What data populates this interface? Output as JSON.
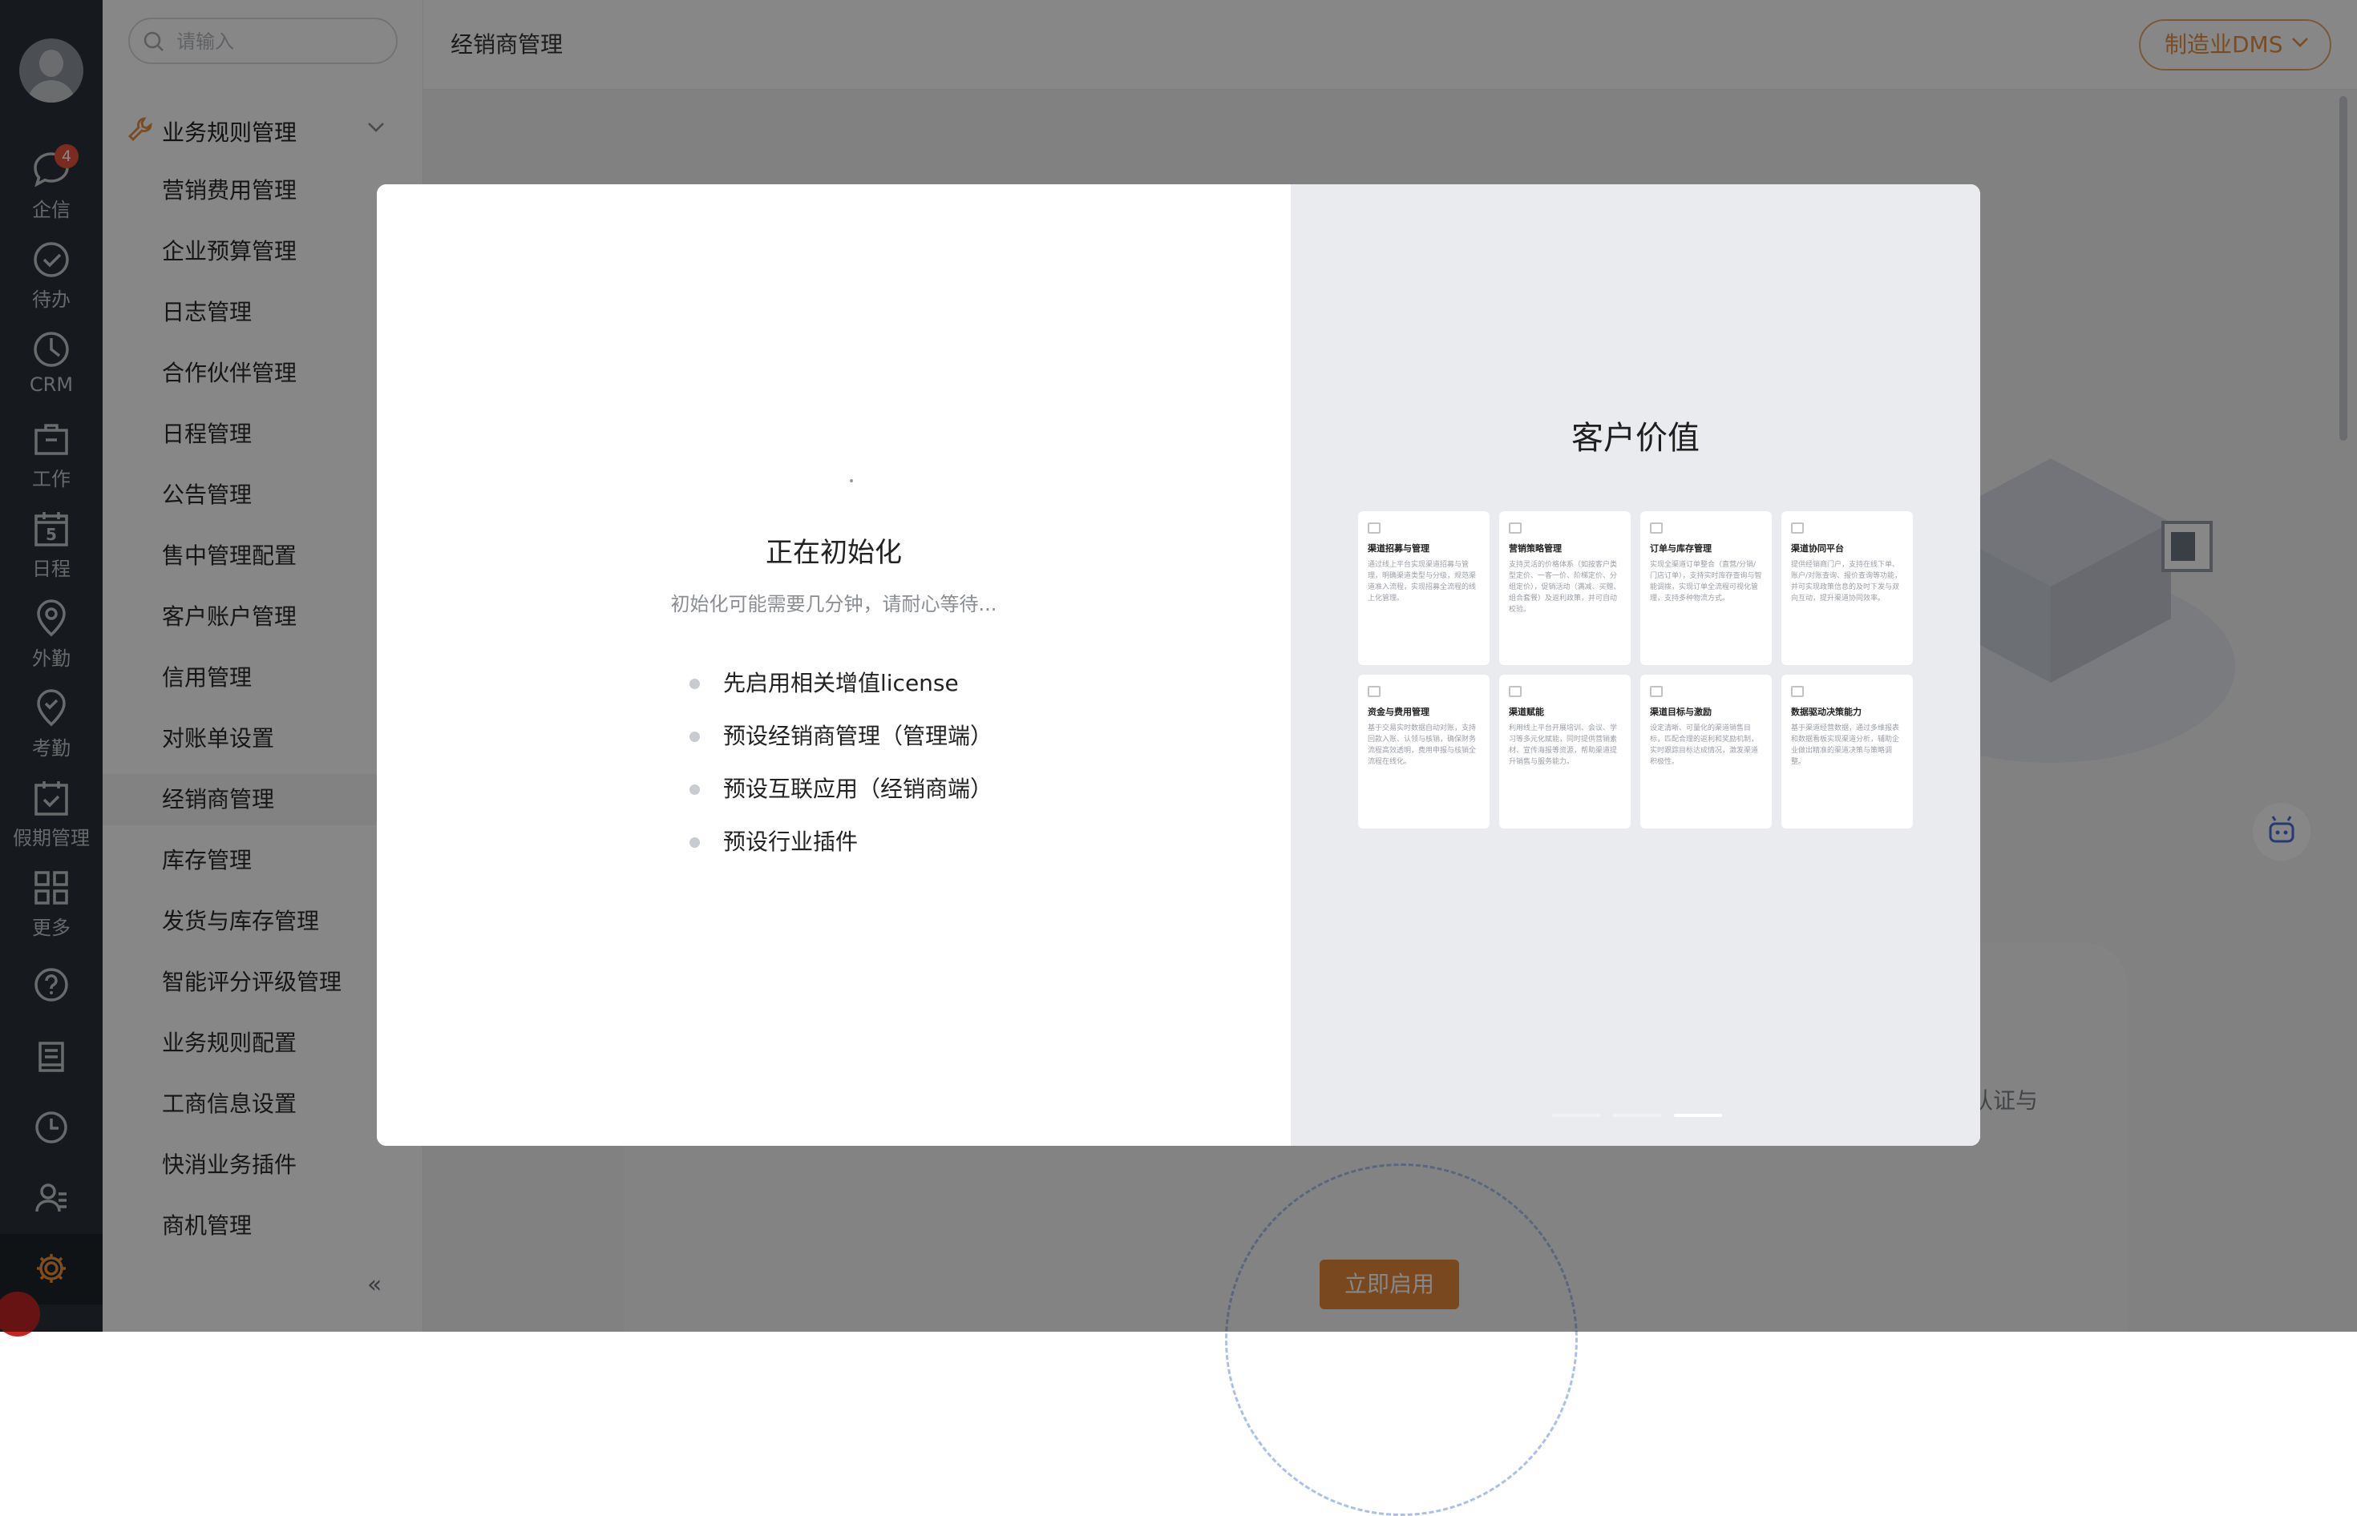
{
  "rail": {
    "items": [
      {
        "label": "企信",
        "icon": "chat-bubble-icon",
        "badge": "4"
      },
      {
        "label": "待办",
        "icon": "check-circle-icon"
      },
      {
        "label": "CRM",
        "icon": "clock-pie-icon"
      },
      {
        "label": "工作",
        "icon": "briefcase-icon"
      },
      {
        "label": "日程",
        "icon": "calendar-icon",
        "date": "5"
      },
      {
        "label": "外勤",
        "icon": "location-pin-icon"
      },
      {
        "label": "考勤",
        "icon": "check-pin-icon"
      },
      {
        "label": "假期管理",
        "icon": "calendar-check-icon"
      },
      {
        "label": "更多",
        "icon": "grid-icon"
      }
    ],
    "tools": [
      "help-icon",
      "notebook-icon",
      "history-clock-icon",
      "contacts-icon",
      "settings-gear-icon"
    ],
    "active_color": "#e8913f"
  },
  "sidebar": {
    "search_placeholder": "请输入",
    "group_label": "业务规则管理",
    "items": [
      {
        "label": "营销费用管理"
      },
      {
        "label": "企业预算管理"
      },
      {
        "label": "日志管理"
      },
      {
        "label": "合作伙伴管理"
      },
      {
        "label": "日程管理"
      },
      {
        "label": "公告管理"
      },
      {
        "label": "售中管理配置"
      },
      {
        "label": "客户账户管理"
      },
      {
        "label": "信用管理"
      },
      {
        "label": "对账单设置"
      },
      {
        "label": "经销商管理"
      },
      {
        "label": "库存管理"
      },
      {
        "label": "发货与库存管理"
      },
      {
        "label": "智能评分评级管理"
      },
      {
        "label": "业务规则配置"
      },
      {
        "label": "工商信息设置"
      },
      {
        "label": "快消业务插件"
      },
      {
        "label": "商机管理"
      }
    ],
    "active_item": "经销商管理",
    "collapse_label": "«"
  },
  "header": {
    "title": "经销商管理",
    "scenario_button": "制造业DMS"
  },
  "background_page": {
    "partial_text": "认证与",
    "enable_button": "立即启用"
  },
  "modal": {
    "left": {
      "title": "正在初始化",
      "subtitle": "初始化可能需要几分钟，请耐心等待...",
      "steps": [
        "先启用相关增值license",
        "预设经销商管理（管理端）",
        "预设互联应用（经销商端）",
        "预设行业插件"
      ]
    },
    "right": {
      "title": "客户价值",
      "cards": [
        {
          "title": "渠道招募与管理",
          "desc": "通过线上平台实现渠道招募与管理，明确渠道类型与分级，规范渠道准入流程，实现招募全流程的线上化管理。"
        },
        {
          "title": "营销策略管理",
          "desc": "支持灵活的价格体系（如按客户类型定价、一客一价、阶梯定价、分组定价），促销活动（满减、买赠、组合套餐）及返利政策，并可自动校验。"
        },
        {
          "title": "订单与库存管理",
          "desc": "实现全渠道订单整合（直营/分销/门店订单），支持实时库存查询与智能调拨，实现订单全流程可视化管理，支持多种物流方式。"
        },
        {
          "title": "渠道协同平台",
          "desc": "提供经销商门户，支持在线下单、账户/对账查询、报价查询等功能，并可实现政策信息的及时下发与双向互动，提升渠道协同效率。"
        },
        {
          "title": "资金与费用管理",
          "desc": "基于交易实时数据自动对账，支持回款入账、认领与核销，确保财务流程高效透明，费用申报与核销全流程在线化。"
        },
        {
          "title": "渠道赋能",
          "desc": "利用线上平台开展培训、会议、学习等多元化赋能，同时提供营销素材、宣传海报等资源，帮助渠道提升销售与服务能力。"
        },
        {
          "title": "渠道目标与激励",
          "desc": "设定清晰、可量化的渠道销售目标，匹配合理的返利和奖励机制，实时跟踪目标达成情况，激发渠道积极性。"
        },
        {
          "title": "数据驱动决策能力",
          "desc": "基于渠道经营数据，通过多维报表和数据看板实现渠道分析，辅助企业做出精准的渠道决策与策略调整。"
        }
      ],
      "page_count": 3,
      "current_page": 3
    }
  },
  "colors": {
    "rail_bg": "#2b3139",
    "accent": "#e6883a",
    "overlay": "rgba(0,0,0,0.47)"
  }
}
